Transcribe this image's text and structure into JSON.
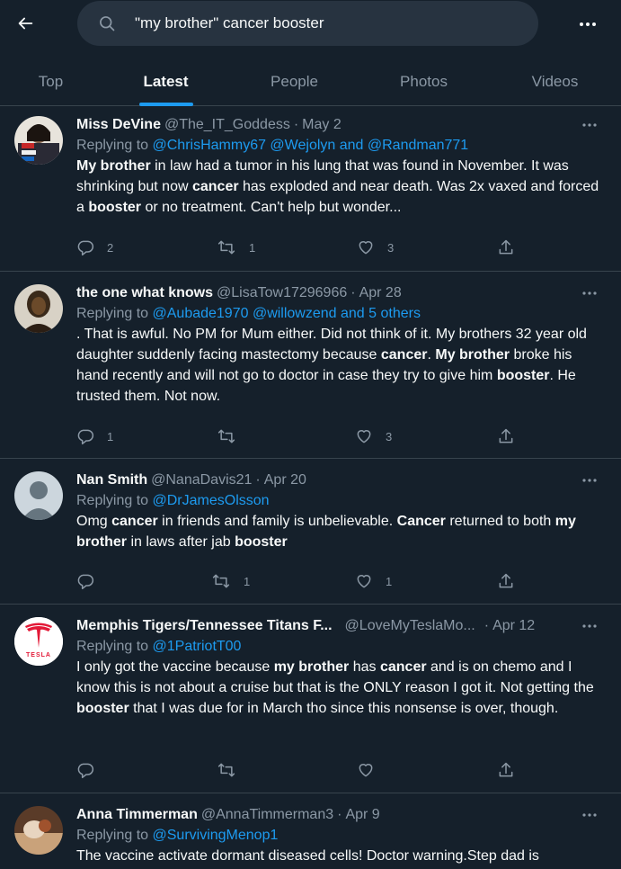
{
  "search": {
    "query": "\"my brother\" cancer booster"
  },
  "tabs": [
    {
      "label": "Top",
      "active": false
    },
    {
      "label": "Latest",
      "active": true
    },
    {
      "label": "People",
      "active": false
    },
    {
      "label": "Photos",
      "active": false
    },
    {
      "label": "Videos",
      "active": false
    }
  ],
  "colors": {
    "background": "#15202b",
    "accent": "#1d9bf0",
    "muted": "#8b98a5",
    "divider": "#38444d"
  },
  "tweets": [
    {
      "name": "Miss DeVine",
      "handle": "@The_IT_Goddess",
      "separator": "·",
      "date": "May 2",
      "replying_prefix": "Replying to",
      "mentions": "@ChrisHammy67 @Wejolyn and @Randman771",
      "text_parts": [
        {
          "t": "My brother",
          "b": true
        },
        {
          "t": " in law had a tumor in his lung that was found in November. It was shrinking but now ",
          "b": false
        },
        {
          "t": "cancer",
          "b": true
        },
        {
          "t": " has exploded and near death. Was 2x vaxed and forced a ",
          "b": false
        },
        {
          "t": "booster",
          "b": true
        },
        {
          "t": " or no treatment. Can't help but wonder...",
          "b": false
        }
      ],
      "replies": "2",
      "retweets": "1",
      "likes": "3"
    },
    {
      "name": "the one what knows",
      "handle": "@LisaTow17296966",
      "separator": "·",
      "date": "Apr 28",
      "replying_prefix": "Replying to",
      "mentions": "@Aubade1970 @willowzend and 5 others",
      "text_parts": [
        {
          "t": ". That is awful. No PM for Mum either. Did not think of it. My brothers 32 year old daughter suddenly facing mastectomy because ",
          "b": false
        },
        {
          "t": "cancer",
          "b": true
        },
        {
          "t": ". ",
          "b": false
        },
        {
          "t": "My brother",
          "b": true
        },
        {
          "t": " broke his hand recently and will not go to doctor in case they try to give him ",
          "b": false
        },
        {
          "t": "booster",
          "b": true
        },
        {
          "t": ". He trusted them. Not now.",
          "b": false
        }
      ],
      "replies": "1",
      "retweets": "",
      "likes": "3"
    },
    {
      "name": "Nan Smith",
      "handle": "@NanaDavis21",
      "separator": "·",
      "date": "Apr 20",
      "replying_prefix": "Replying to",
      "mentions": "@DrJamesOlsson",
      "text_parts": [
        {
          "t": "Omg ",
          "b": false
        },
        {
          "t": "cancer",
          "b": true
        },
        {
          "t": " in friends and family is unbelievable. ",
          "b": false
        },
        {
          "t": "Cancer",
          "b": true
        },
        {
          "t": " returned to both ",
          "b": false
        },
        {
          "t": "my brother",
          "b": true
        },
        {
          "t": " in laws after jab ",
          "b": false
        },
        {
          "t": "booster",
          "b": true
        }
      ],
      "replies": "",
      "retweets": "1",
      "likes": "1"
    },
    {
      "name": "Memphis Tigers/Tennessee Titans F...",
      "handle": "@LoveMyTeslaMo...",
      "separator": "·",
      "date": "Apr 12",
      "replying_prefix": "Replying to",
      "mentions": "@1PatriotT00",
      "avatar_text": "TESLA",
      "text_parts": [
        {
          "t": "I only got the vaccine because ",
          "b": false
        },
        {
          "t": "my brother",
          "b": true
        },
        {
          "t": " has ",
          "b": false
        },
        {
          "t": "cancer",
          "b": true
        },
        {
          "t": " and is on chemo and I know this is not about a cruise but that is the ONLY reason I got it. Not getting the ",
          "b": false
        },
        {
          "t": "booster",
          "b": true
        },
        {
          "t": " that I was due for in March tho since this nonsense is over, though.",
          "b": false
        }
      ],
      "replies": "",
      "retweets": "",
      "likes": ""
    },
    {
      "name": "Anna Timmerman",
      "handle": "@AnnaTimmerman3",
      "separator": "·",
      "date": "Apr 9",
      "replying_prefix": "Replying to",
      "mentions": "@SurvivingMenop1",
      "text_parts": [
        {
          "t": "The vaccine activate dormant diseased cells! Doctor warning.Step dad is",
          "b": false
        }
      ],
      "replies": "",
      "retweets": "",
      "likes": ""
    }
  ]
}
